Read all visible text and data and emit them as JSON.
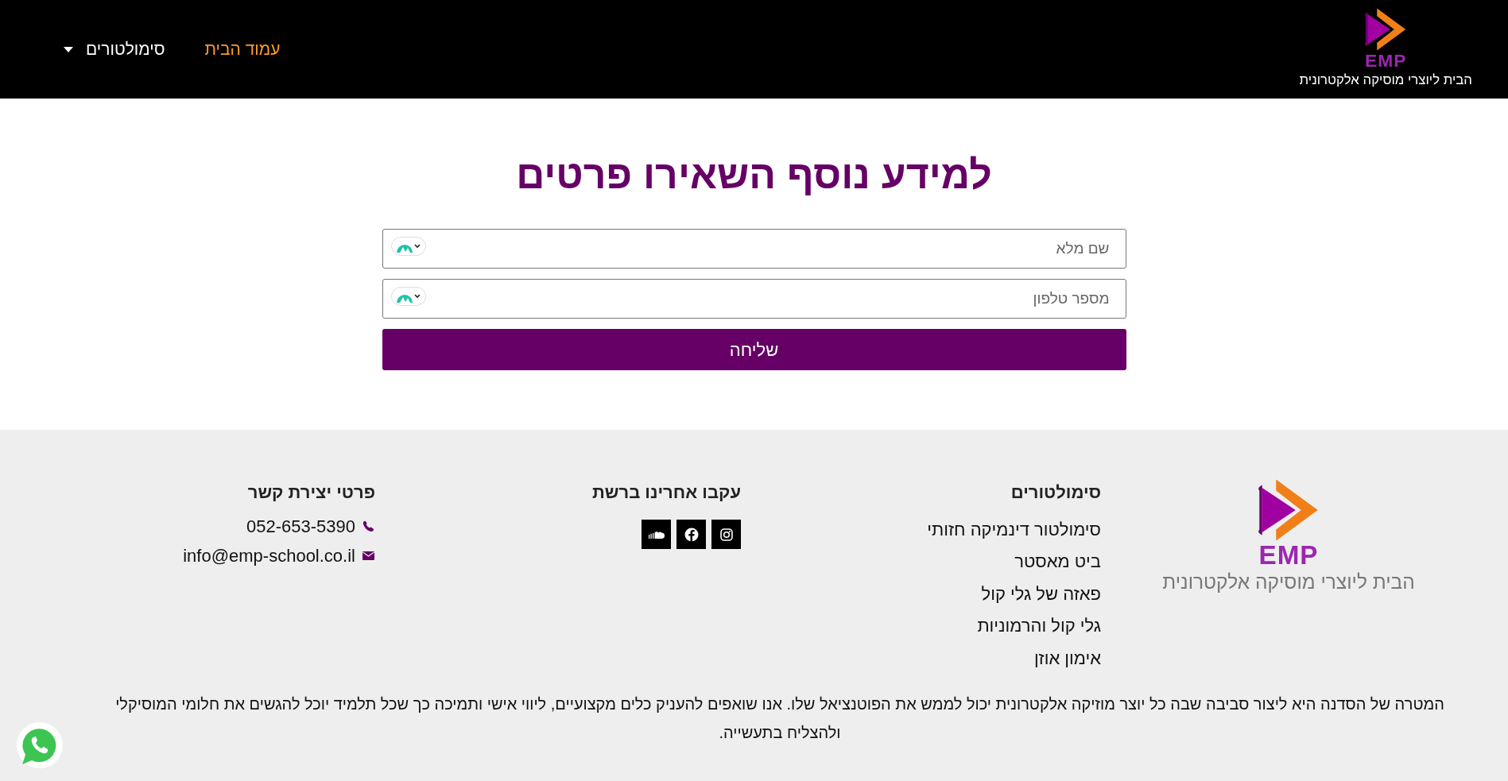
{
  "header": {
    "logo": {
      "wordmark": "EMP",
      "tagline": "הבית ליוצרי מוסיקה אלקטרונית"
    },
    "nav": [
      {
        "label": "עמוד הבית",
        "selected": true,
        "kind": "link"
      },
      {
        "label": "סימולטורים",
        "selected": false,
        "kind": "dropdown"
      }
    ]
  },
  "form": {
    "title": "למידע נוסף השאירו פרטים",
    "fields": [
      {
        "placeholder": "שם מלא"
      },
      {
        "placeholder": "מספר טלפון"
      }
    ],
    "submit": "שליחה"
  },
  "footer": {
    "logo": {
      "wordmark": "EMP",
      "tagline": "הבית ליוצרי מוסיקה אלקטרונית"
    },
    "simulators": {
      "heading": "סימולטורים",
      "links": [
        "סימולטור דינמיקה חזותי",
        "ביט מאסטר",
        "פאזה של גלי קול",
        "גלי קול והרמוניות",
        "אימון אוזן"
      ]
    },
    "social": {
      "heading": "עקבו אחרינו ברשת",
      "links": [
        {
          "kind": "instagram"
        },
        {
          "kind": "facebook"
        },
        {
          "kind": "soundcloud"
        }
      ]
    },
    "contact": {
      "heading": "פרטי יצירת קשר",
      "items": [
        {
          "kind": "phone",
          "text": "052-653-5390"
        },
        {
          "kind": "email",
          "text": "info@emp-school.co.il"
        }
      ]
    },
    "mission": "המטרה של הסדנה היא ליצור סביבה שבה כל יוצר מוזיקה אלקטרונית יכול לממש את הפוטנציאל שלו. אנו שואפים להעניק כלים מקצועיים, ליווי אישי ותמיכה כך שכל תלמיד יוכל להגשים את חלומי המוסיקלי ולהצליח בתעשייה."
  }
}
